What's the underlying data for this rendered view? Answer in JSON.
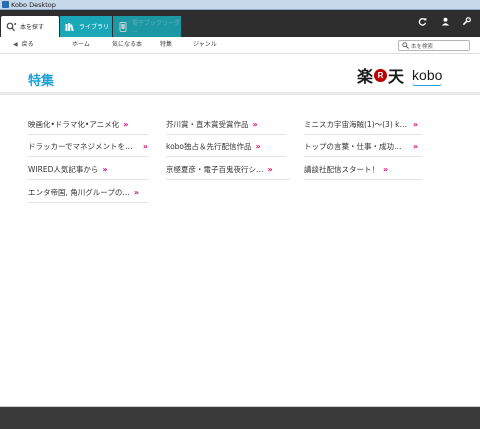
{
  "window": {
    "title": "Kobo Desktop"
  },
  "tabs": [
    {
      "label": "本を探す",
      "icon": "search-books-icon"
    },
    {
      "label": "ライブラリ",
      "icon": "library-icon"
    },
    {
      "label": "電子ブックリーダー",
      "icon": "ereader-icon"
    }
  ],
  "header_icons": [
    "sync-icon",
    "account-icon",
    "settings-wrench-icon"
  ],
  "nav": {
    "back_label": "戻る",
    "links": [
      "ホーム",
      "気になる本",
      "特集",
      "ジャンル"
    ],
    "search_placeholder": "本を検索"
  },
  "section": {
    "title": "特集"
  },
  "logo": {
    "part1": "楽",
    "badge": "R",
    "part2": "天",
    "brand": "kobo"
  },
  "columns": [
    {
      "items": [
        "映画化•ドラマ化•アニメ化",
        "ドラッカーでマネジメントを学ぶ",
        "WIRED人気記事から",
        "エンタ帝国, 角川グループの…"
      ]
    },
    {
      "items": [
        "芥川賞・直木賞受賞作品",
        "kobo独占＆先行配信作品",
        "京極夏彦・電子百鬼夜行シ…"
      ]
    },
    {
      "items": [
        "ミニスカ宇宙海賊(1)〜(3) k…",
        "トップの言葉・仕事・成功に…",
        "講談社配信スタート！"
      ]
    }
  ],
  "chevron": "»",
  "colors": {
    "accent_blue": "#1ba2d6",
    "tab_teal": "#1aa7b8",
    "chevron_pink": "#d1006f",
    "header_dark": "#2e2e2e",
    "rakuten_red": "#bf0000"
  }
}
